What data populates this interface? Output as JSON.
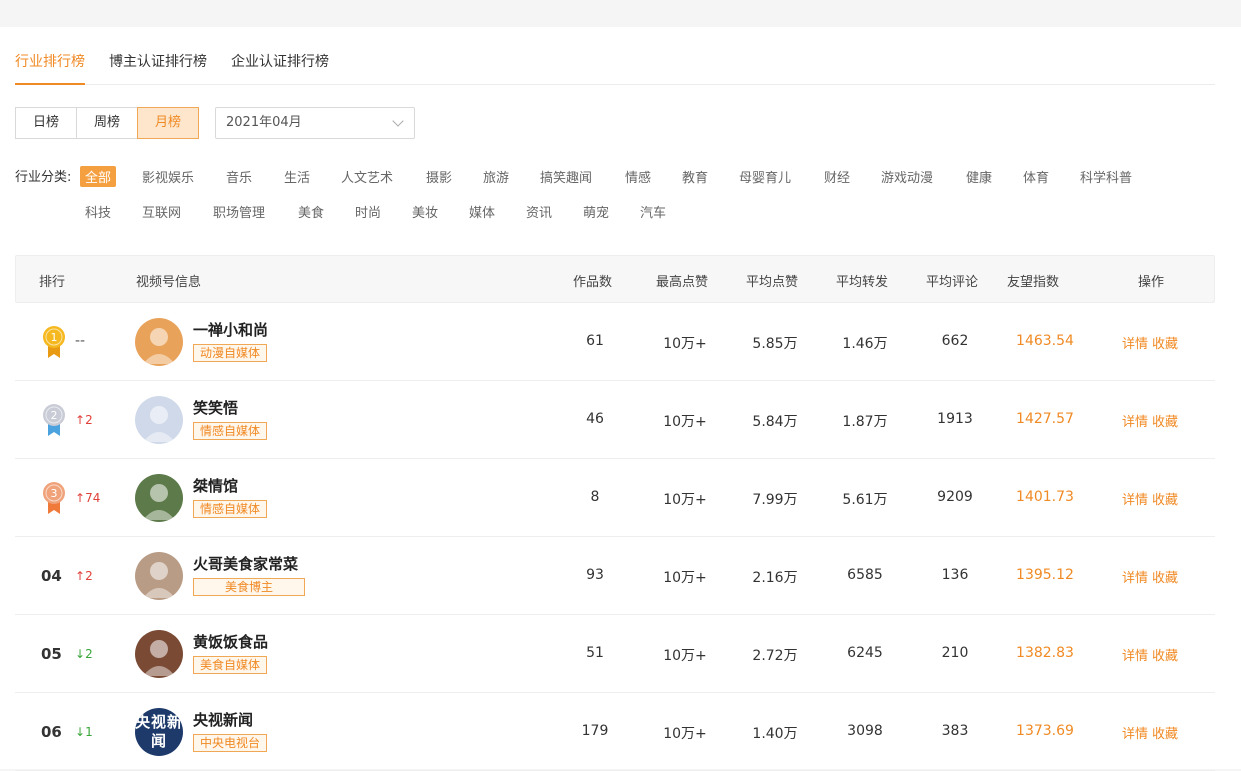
{
  "tabs": [
    "行业排行榜",
    "博主认证排行榜",
    "企业认证排行榜"
  ],
  "period": {
    "options": [
      "日榜",
      "周榜",
      "月榜"
    ],
    "selected": "月榜"
  },
  "month_select": {
    "value": "2021年04月"
  },
  "category_filter": {
    "label": "行业分类:",
    "row1": [
      "全部",
      "影视娱乐",
      "音乐",
      "生活",
      "人文艺术",
      "摄影",
      "旅游",
      "搞笑趣闻",
      "情感",
      "教育",
      "母婴育儿",
      "财经",
      "游戏动漫",
      "健康",
      "体育",
      "科学科普"
    ],
    "row2": [
      "科技",
      "互联网",
      "职场管理",
      "美食",
      "时尚",
      "美妆",
      "媒体",
      "资讯",
      "萌宠",
      "汽车"
    ],
    "selected": "全部"
  },
  "table": {
    "headers": [
      "排行",
      "视频号信息",
      "作品数",
      "最高点赞",
      "平均点赞",
      "平均转发",
      "平均评论",
      "友望指数",
      "操作"
    ],
    "actions": [
      "详情",
      "收藏"
    ],
    "rows": [
      {
        "rank": "1",
        "medal": "gold",
        "trend": "none",
        "trend_text": "--",
        "name": "一禅小和尚",
        "tag": "动漫自媒体",
        "works": "61",
        "max_likes": "10万+",
        "avg_likes": "5.85万",
        "avg_shares": "1.46万",
        "avg_comments": "662",
        "index": "1463.54",
        "avatar_color": "#e9a25a"
      },
      {
        "rank": "2",
        "medal": "silver",
        "trend": "up",
        "trend_text": "2",
        "name": "笑笑悟",
        "tag": "情感自媒体",
        "works": "46",
        "max_likes": "10万+",
        "avg_likes": "5.84万",
        "avg_shares": "1.87万",
        "avg_comments": "1913",
        "index": "1427.57",
        "avatar_color": "#cfd9ea"
      },
      {
        "rank": "3",
        "medal": "bronze",
        "trend": "up",
        "trend_text": "74",
        "name": "桀情馆",
        "tag": "情感自媒体",
        "works": "8",
        "max_likes": "10万+",
        "avg_likes": "7.99万",
        "avg_shares": "5.61万",
        "avg_comments": "9209",
        "index": "1401.73",
        "avatar_color": "#5d7a4a"
      },
      {
        "rank": "04",
        "medal": "",
        "trend": "up",
        "trend_text": "2",
        "name": "火哥美食家常菜",
        "tag": "美食博主",
        "works": "93",
        "max_likes": "10万+",
        "avg_likes": "2.16万",
        "avg_shares": "6585",
        "avg_comments": "136",
        "index": "1395.12",
        "avatar_color": "#b99c86"
      },
      {
        "rank": "05",
        "medal": "",
        "trend": "down",
        "trend_text": "2",
        "name": "黄饭饭食品",
        "tag": "美食自媒体",
        "works": "51",
        "max_likes": "10万+",
        "avg_likes": "2.72万",
        "avg_shares": "6245",
        "avg_comments": "210",
        "index": "1382.83",
        "avatar_color": "#7a4a35"
      },
      {
        "rank": "06",
        "medal": "",
        "trend": "down",
        "trend_text": "1",
        "name": "央视新闻",
        "tag": "中央电视台",
        "works": "179",
        "max_likes": "10万+",
        "avg_likes": "1.40万",
        "avg_shares": "3098",
        "avg_comments": "383",
        "index": "1373.69",
        "avatar_color": "#1d3a6b",
        "avatar_text": "央视新闻"
      }
    ]
  },
  "colors": {
    "accent": "#f08a24",
    "up": "#e0403a",
    "down": "#3aa63a"
  }
}
